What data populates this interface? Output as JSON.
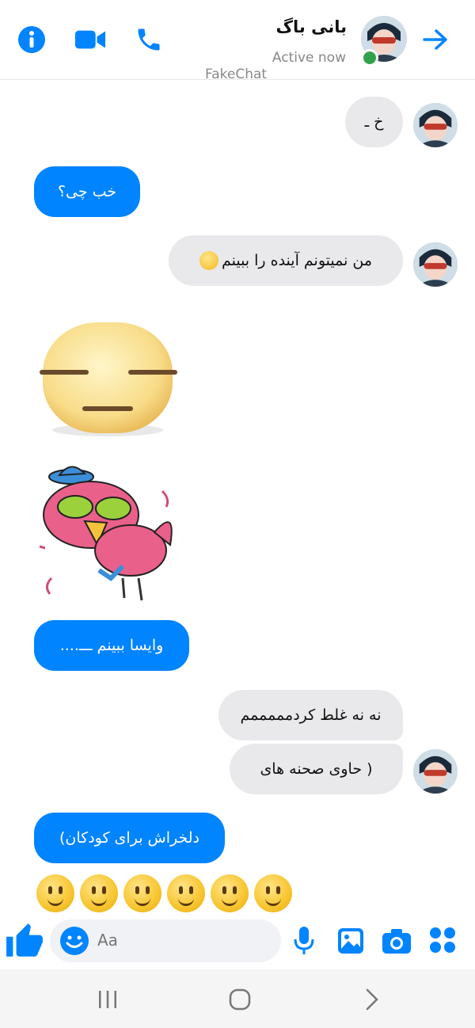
{
  "header": {
    "contact_name": "بانی باگ",
    "status": "Active now",
    "watermark": "FakeChat",
    "icons": [
      "info-icon",
      "video-camera-icon",
      "phone-icon",
      "arrow-right-icon"
    ]
  },
  "messages": [
    {
      "side": "in",
      "text": "خ ـ"
    },
    {
      "side": "out",
      "text": "خب چی؟"
    },
    {
      "side": "in",
      "text": "من نمیتونم آینده را ببینم"
    },
    {
      "side": "in",
      "sticker": "expressionless-face-sticker"
    },
    {
      "side": "in",
      "sticker": "angry-bird-sticker"
    },
    {
      "side": "out",
      "text": "وایسا ببینم ـــ...."
    },
    {
      "side": "in",
      "text": "نه نه غلط کردمممممم"
    },
    {
      "side": "in",
      "text": "( حاوی صحنه های"
    },
    {
      "side": "out",
      "text": "دلخراش برای کودکان)"
    }
  ],
  "emoji_row": {
    "count": 6,
    "name": "slightly-smiling-face"
  },
  "composer": {
    "placeholder": "Aa",
    "icons": [
      "thumbs-up-icon",
      "emoji-icon",
      "microphone-icon",
      "image-icon",
      "camera-icon",
      "apps-icon"
    ]
  },
  "nav": {
    "icons": [
      "recent-apps-icon",
      "home-icon",
      "back-icon"
    ]
  },
  "colors": {
    "accent": "#0084ff",
    "incoming_bubble": "#e9e9eb",
    "online": "#31a24c"
  }
}
